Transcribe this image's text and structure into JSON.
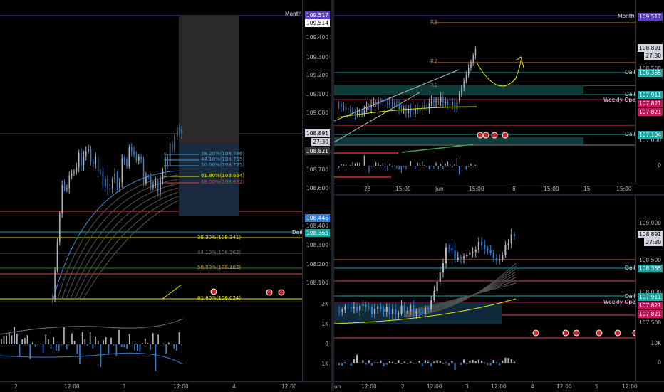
{
  "colors": {
    "up": "#b2b5be",
    "down": "#2f7fd6",
    "monthly": "#5b3fbf",
    "daily": "#1aa3a3",
    "weekly": "#c2185b",
    "fib_yellow": "#e6e600",
    "fib_red": "#d14b4b",
    "fib_blue": "#4a7fc1",
    "gray": "#4a4d56"
  },
  "left": {
    "price_ticks": [
      "109.400",
      "109.300",
      "109.200",
      "109.100",
      "109.000",
      "108.700",
      "108.600",
      "108.400",
      "108.300",
      "108.200",
      "108.100"
    ],
    "tags": {
      "monthly": "109.517",
      "top": "109.514",
      "last": "108.891",
      "countdown": "27:30",
      "weekly": "108.821",
      "blue": "108.446",
      "daily": "108.365"
    },
    "line_labels": {
      "monthly": "Monthly",
      "daily": "Daily"
    },
    "fib_short": [
      "38.20%(108.786)",
      "44.10%(108.755)",
      "50.00%(108.725)",
      "61.80%(108.664)",
      "68.00%(108.632)"
    ],
    "fib_long": [
      "38.20%(108.341)",
      "44.10%(108.262)",
      "50.00%(108.183)",
      "61.80%(108.024)"
    ],
    "vol_ticks": [
      "2K",
      "1K",
      "0",
      "-1K"
    ],
    "time_labels": [
      "2",
      "12:00",
      "3",
      "12:00",
      "4",
      "12:00"
    ]
  },
  "top_right": {
    "price_ticks": [
      "108.500",
      "107.000",
      "0"
    ],
    "tags": {
      "monthly": "109.517",
      "last": "108.891",
      "countdown": "27:30",
      "daily1": "108.365",
      "daily2": "107.911",
      "weekly1": "107.821",
      "weekly2": "107.821",
      "daily3": "107.104"
    },
    "line_labels": {
      "monthly": "Monthly",
      "daily1": "Daily",
      "daily2": "Daily",
      "weekly": "Weekly Open",
      "daily3": "Daily"
    },
    "pivots": [
      "R3",
      "R2",
      "R1"
    ],
    "time_labels": [
      "25",
      "15:00",
      "Jun",
      "15:00",
      "8",
      "15:00",
      "15",
      "15:00"
    ]
  },
  "bottom_right": {
    "price_ticks": [
      "109.000",
      "108.500",
      "108.000",
      "107.500",
      "10K",
      "0"
    ],
    "tags": {
      "last": "108.891",
      "countdown": "27:30",
      "daily1": "108.365",
      "daily2": "107.911",
      "weekly1": "107.821",
      "weekly2": "107.821"
    },
    "line_labels": {
      "daily1": "Daily",
      "daily2": "Daily",
      "weekly": "Weekly Open"
    },
    "time_labels": [
      "un",
      "12:00",
      "2",
      "12:00",
      "3",
      "12:00",
      "4",
      "12:00",
      "5",
      "12:00"
    ]
  }
}
